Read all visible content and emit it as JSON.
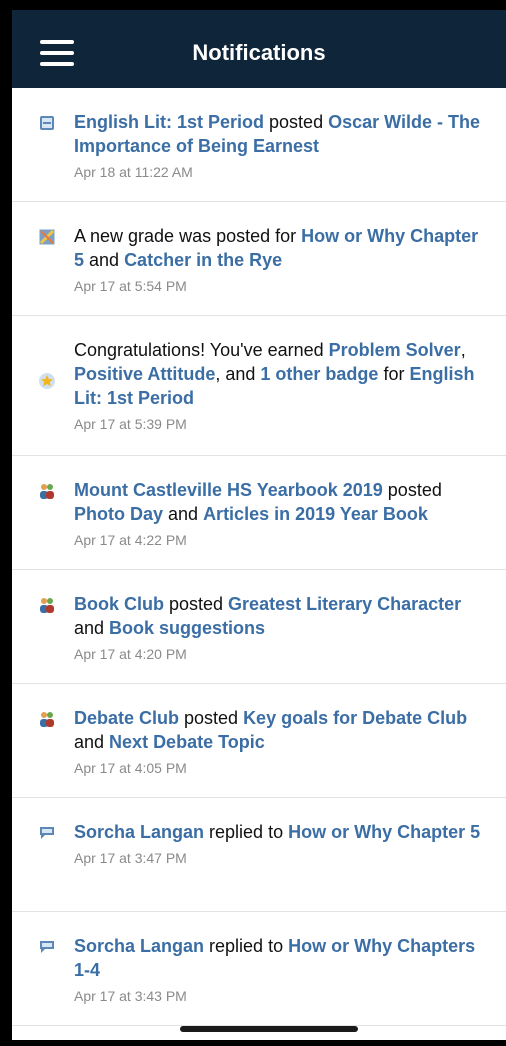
{
  "header": {
    "title": "Notifications",
    "menu_icon": "hamburger-menu-icon"
  },
  "notifications": [
    {
      "icon": "assignment-icon",
      "parts": [
        {
          "t": "English Lit: 1st Period",
          "link": true
        },
        {
          "t": " posted ",
          "link": false
        },
        {
          "t": "Oscar Wilde - The Importance of Being Earnest",
          "link": true
        }
      ],
      "time": "Apr 18 at 11:22 AM"
    },
    {
      "icon": "grade-icon",
      "parts": [
        {
          "t": "A new grade was posted for ",
          "link": false
        },
        {
          "t": "How or Why Chapter 5",
          "link": true
        },
        {
          "t": " and ",
          "link": false
        },
        {
          "t": "Catcher in the Rye",
          "link": true
        }
      ],
      "time": "Apr 17 at 5:54 PM"
    },
    {
      "icon": "badge-star-icon",
      "parts": [
        {
          "t": "Congratulations! You've earned ",
          "link": false
        },
        {
          "t": "Problem Solver",
          "link": true
        },
        {
          "t": ", ",
          "link": false
        },
        {
          "t": "Positive Attitude",
          "link": true
        },
        {
          "t": ", and ",
          "link": false
        },
        {
          "t": "1 other badge",
          "link": true
        },
        {
          "t": " for ",
          "link": false
        },
        {
          "t": "English Lit: 1st Period",
          "link": true
        }
      ],
      "time": "Apr 17 at 5:39 PM"
    },
    {
      "icon": "group-icon",
      "parts": [
        {
          "t": "Mount Castleville HS Yearbook 2019",
          "link": true
        },
        {
          "t": " posted ",
          "link": false
        },
        {
          "t": "Photo Day",
          "link": true
        },
        {
          "t": " and ",
          "link": false
        },
        {
          "t": "Articles in 2019 Year Book",
          "link": true
        }
      ],
      "time": "Apr 17 at 4:22 PM"
    },
    {
      "icon": "group-icon",
      "parts": [
        {
          "t": "Book Club",
          "link": true
        },
        {
          "t": " posted ",
          "link": false
        },
        {
          "t": "Greatest Literary Character",
          "link": true
        },
        {
          "t": " and ",
          "link": false
        },
        {
          "t": "Book suggestions",
          "link": true
        }
      ],
      "time": "Apr 17 at 4:20 PM"
    },
    {
      "icon": "group-icon",
      "parts": [
        {
          "t": "Debate Club",
          "link": true
        },
        {
          "t": " posted ",
          "link": false
        },
        {
          "t": "Key goals for Debate Club",
          "link": true
        },
        {
          "t": " and ",
          "link": false
        },
        {
          "t": "Next Debate Topic",
          "link": true
        }
      ],
      "time": "Apr 17 at 4:05 PM"
    },
    {
      "icon": "comment-icon",
      "parts": [
        {
          "t": "Sorcha Langan",
          "link": true
        },
        {
          "t": " replied to ",
          "link": false
        },
        {
          "t": "How or Why Chapter 5",
          "link": true
        }
      ],
      "time": "Apr 17 at 3:47 PM"
    },
    {
      "icon": "comment-icon",
      "parts": [
        {
          "t": "Sorcha Langan",
          "link": true
        },
        {
          "t": " replied to ",
          "link": false
        },
        {
          "t": "How or Why Chapters 1-4",
          "link": true
        }
      ],
      "time": "Apr 17 at 3:43 PM"
    }
  ],
  "colors": {
    "header_bg": "#0f2539",
    "link": "#3b6ea5",
    "time": "#8a8a8a"
  }
}
